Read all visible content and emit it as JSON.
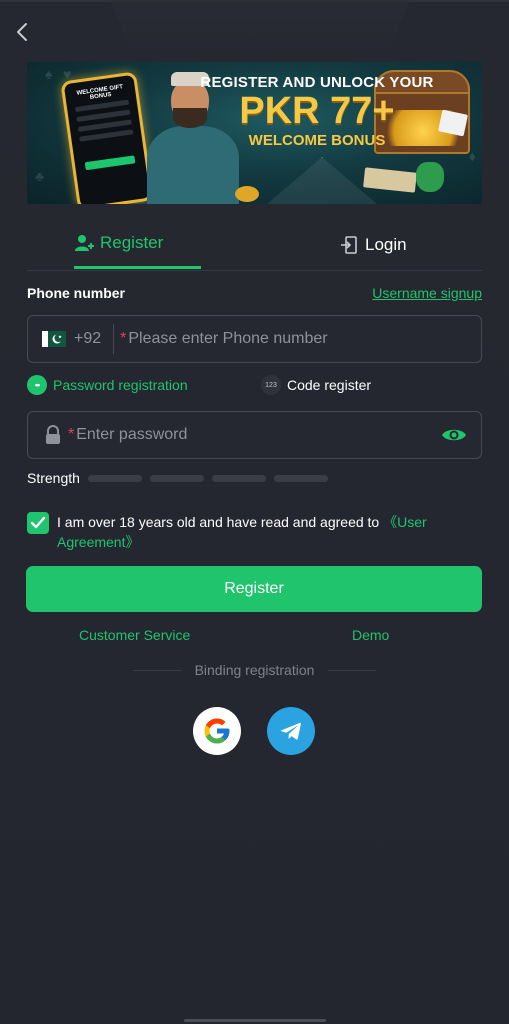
{
  "banner": {
    "line1": "REGISTER AND UNLOCK YOUR",
    "line2": "PKR 77+",
    "line3": "WELCOME BONUS",
    "phone_text": "WELCOME GIFT BONUS"
  },
  "tabs": [
    {
      "label": "Register",
      "icon": "add-user-icon",
      "active": true
    },
    {
      "label": "Login",
      "icon": "login-icon",
      "active": false
    }
  ],
  "phone": {
    "label": "Phone number",
    "username_signup": "Username signup",
    "country_code": "+92",
    "required_mark": "*",
    "placeholder": "Please enter Phone number",
    "flag_icon": "pakistan-flag-icon"
  },
  "registration_types": [
    {
      "label": "Password registration",
      "icon": "password-dots-icon",
      "active": true
    },
    {
      "label": "Code register",
      "icon": "code-123-icon",
      "active": false
    }
  ],
  "password": {
    "required_mark": "*",
    "placeholder": "Enter password",
    "lock_icon": "lock-icon",
    "eye_icon": "eye-icon"
  },
  "strength": {
    "label": "Strength",
    "bars": 4
  },
  "agreement": {
    "checked": true,
    "text": "I am over 18 years old and have read and agreed to ",
    "link": "《User Agreement》"
  },
  "register_button": "Register",
  "links": {
    "customer_service": "Customer Service",
    "demo": "Demo"
  },
  "binding": {
    "label": "Binding registration",
    "providers": [
      "google",
      "telegram"
    ]
  },
  "colors": {
    "accent": "#1fc46d",
    "background": "#24262f",
    "input_border": "#474a55",
    "required": "#e0455b",
    "telegram": "#2aa3e0"
  }
}
